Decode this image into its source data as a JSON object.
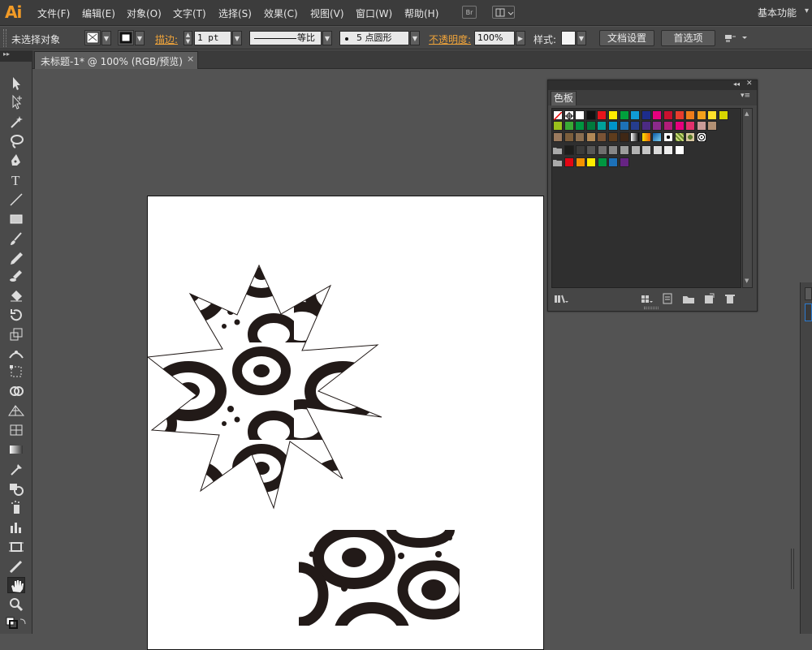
{
  "app": {
    "logo": "Ai"
  },
  "menu": {
    "items": [
      "文件(F)",
      "编辑(E)",
      "对象(O)",
      "文字(T)",
      "选择(S)",
      "效果(C)",
      "视图(V)",
      "窗口(W)",
      "帮助(H)"
    ],
    "bridge_label": "Br",
    "workspace": "基本功能"
  },
  "control": {
    "selection": "未选择对象",
    "stroke_label": "描边:",
    "stroke_weight": "1 pt",
    "stroke_profile": "等比",
    "brush": "5 点圆形",
    "opacity_label": "不透明度:",
    "opacity": "100%",
    "style_label": "样式:",
    "doc_setup": "文档设置",
    "preferences": "首选项"
  },
  "tab": {
    "title": "未标题-1* @ 100% (RGB/预览)",
    "close": "×"
  },
  "panel": {
    "title": "色板",
    "collapse": "◂◂",
    "close": "✕",
    "menu": "▾≡"
  },
  "tools": [
    "selection-tool-icon",
    "direct-selection-tool-icon",
    "magic-wand-tool-icon",
    "lasso-tool-icon",
    "pen-tool-icon",
    "type-tool-icon",
    "line-tool-icon",
    "rectangle-tool-icon",
    "paintbrush-tool-icon",
    "pencil-tool-icon",
    "blob-brush-tool-icon",
    "eraser-tool-icon",
    "rotate-tool-icon",
    "scale-tool-icon",
    "width-tool-icon",
    "free-transform-tool-icon",
    "shape-builder-tool-icon",
    "perspective-grid-tool-icon",
    "mesh-tool-icon",
    "gradient-tool-icon",
    "eyedropper-tool-icon",
    "blend-tool-icon",
    "symbol-sprayer-tool-icon",
    "column-graph-tool-icon",
    "artboard-tool-icon",
    "slice-tool-icon",
    "hand-tool-icon",
    "zoom-tool-icon"
  ],
  "swatches": {
    "row1": [
      "none",
      "registration",
      "#ffffff",
      "#111111",
      "#e8141b",
      "#ffec00",
      "#00a03c",
      "#0f9ad6",
      "#1d2d8c",
      "#e6007e",
      "#c8102e",
      "#e73c2e",
      "#ef7d1a",
      "#f4a11a",
      "#ffe12a",
      "#d7d600"
    ],
    "row2": [
      "#9ac11b",
      "#3aaa35",
      "#009640",
      "#007a3d",
      "#00a19a",
      "#0095c9",
      "#1d71b8",
      "#253d8e",
      "#4c2b83",
      "#8b2a8b",
      "#b01d7a",
      "#e5007d",
      "#e1306c",
      "#c99b98",
      "#b39174"
    ],
    "row3": [
      "#9b7a5e",
      "#7c5e3c",
      "#8a6e50",
      "#b18856",
      "#7a5335",
      "#5e3c1c",
      "#3f2715",
      "gradient-bw",
      "gradient-orange",
      "gradient-blue",
      "pattern-dots",
      "pattern-green",
      "pattern-leaf",
      "pattern-swirl"
    ],
    "row4_folder": [
      "#1d1d1b",
      "#3c3c3b",
      "#575756",
      "#706f6f",
      "#878787",
      "#9d9d9c",
      "#b2b2b2",
      "#c6c6c6",
      "#dadada",
      "#ededed",
      "#ffffff"
    ],
    "row5_folder": [
      "#e30613",
      "#f39200",
      "#ffed00",
      "#009640",
      "#1d71b8",
      "#662483"
    ]
  },
  "colors": {
    "accent": "#f29b26",
    "ui_dark": "#3c3c3c",
    "canvas": "#535353"
  }
}
